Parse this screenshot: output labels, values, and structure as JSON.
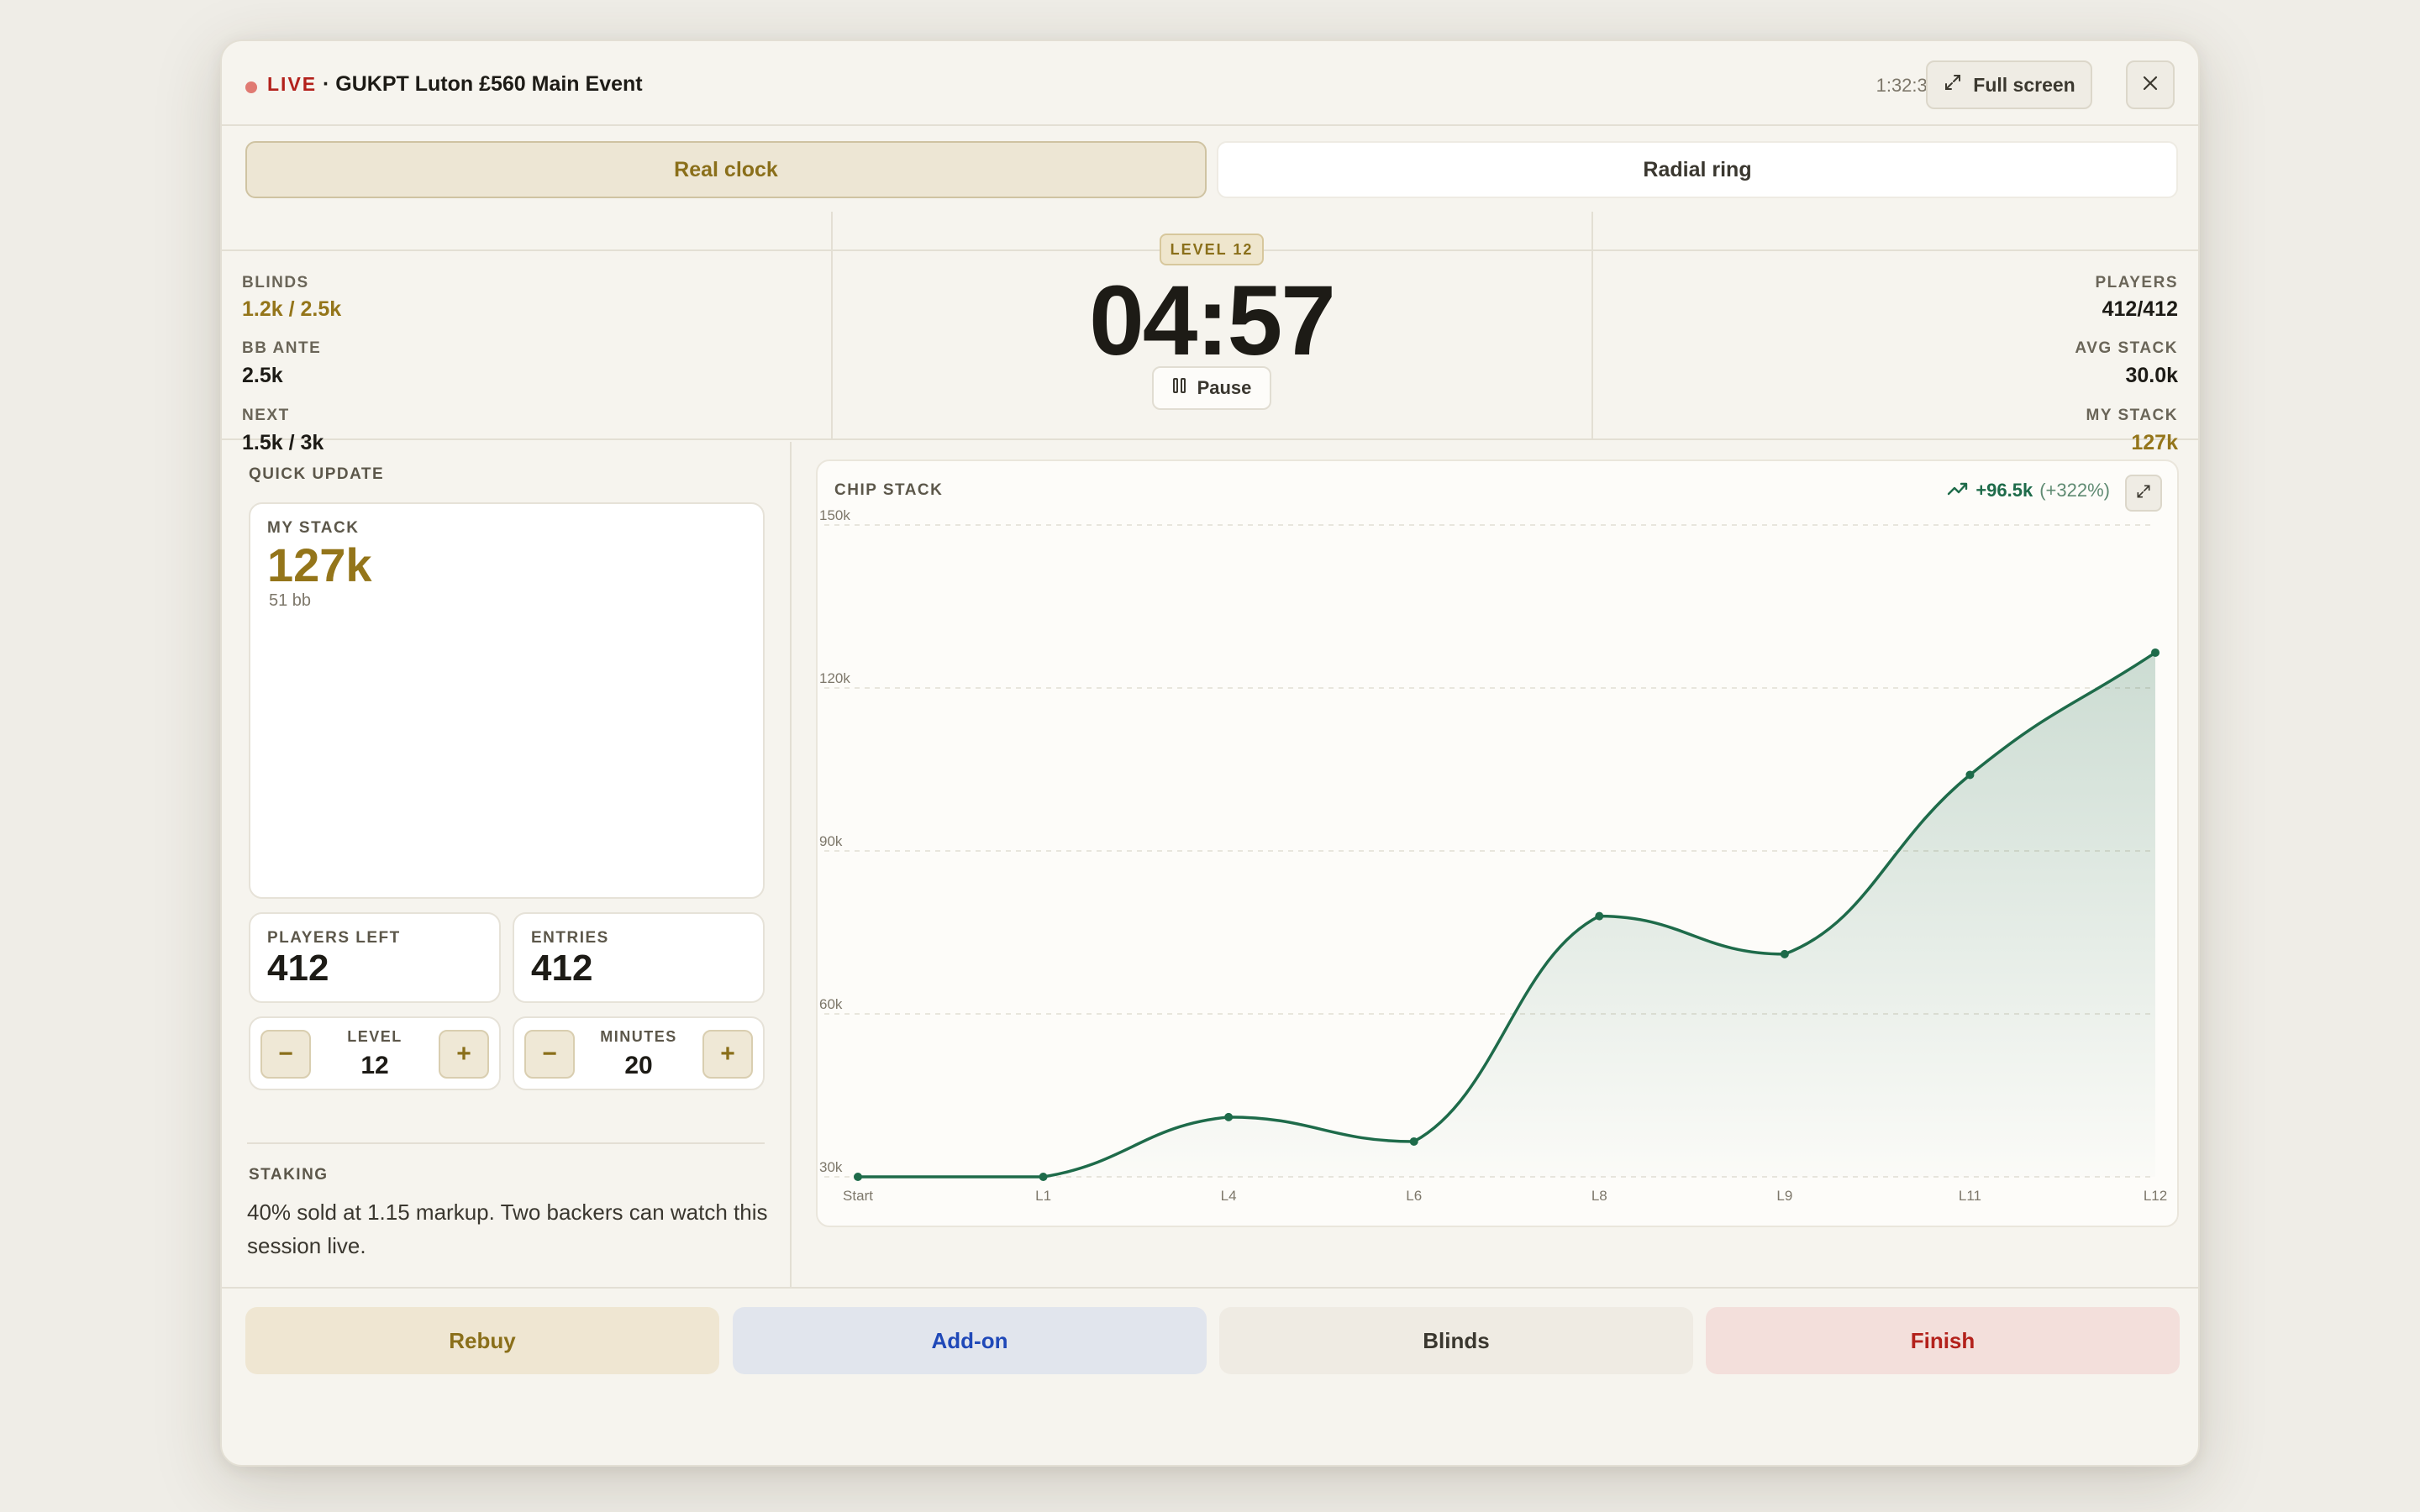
{
  "header": {
    "live_label": "LIVE",
    "event_title": "· GUKPT Luton £560 Main Event",
    "elapsed": "1:32:31",
    "fullscreen_label": "Full screen"
  },
  "tabs": [
    {
      "label": "Real clock",
      "active": true
    },
    {
      "label": "Radial ring",
      "active": false
    }
  ],
  "stats": {
    "blinds_label": "BLINDS",
    "blinds_value": "1.2k / 2.5k",
    "ante_label": "BB ANTE",
    "ante_value": "2.5k",
    "next_label": "NEXT",
    "next_value": "1.5k / 3k",
    "level_badge": "LEVEL 12",
    "clock": "04:57",
    "pause_label": "Pause",
    "players_label": "PLAYERS",
    "players_value": "412/412",
    "avg_stack_label": "AVG STACK",
    "avg_stack_value": "30.0k",
    "my_stack_label": "MY STACK",
    "my_stack_value": "127k"
  },
  "quick_update": {
    "title": "QUICK UPDATE",
    "my_stack_label": "MY STACK",
    "my_stack_value": "127k",
    "my_stack_bb": "51 bb",
    "players_left_label": "PLAYERS LEFT",
    "players_left_value": "412",
    "entries_label": "ENTRIES",
    "entries_value": "412",
    "level_label": "LEVEL",
    "level_value": "12",
    "minutes_label": "MINUTES",
    "minutes_value": "20",
    "minus": "−",
    "plus": "+"
  },
  "staking": {
    "title": "STAKING",
    "text": "40% sold at 1.15 markup. Two backers can watch this session live."
  },
  "chart_panel": {
    "title": "CHIP STACK",
    "delta_value": "+96.5k",
    "delta_pct": "(+322%)"
  },
  "chart_data": {
    "type": "area",
    "title": "CHIP STACK",
    "x": [
      "Start",
      "L1",
      "L4",
      "L6",
      "L8",
      "L9",
      "L11",
      "L12"
    ],
    "series": [
      {
        "values": [
          30000,
          30000,
          41000,
          36500,
          78000,
          71000,
          104000,
          126500
        ]
      }
    ],
    "ylim": [
      30000,
      150000
    ],
    "yticks": [
      30000,
      60000,
      90000,
      120000,
      150000
    ],
    "ytick_labels": [
      "30k",
      "60k",
      "90k",
      "120k",
      "150k"
    ],
    "grid": true,
    "line_color": "#1e6b4a"
  },
  "actions": {
    "rebuy": "Rebuy",
    "addon": "Add-on",
    "blinds": "Blinds",
    "finish": "Finish"
  },
  "colors": {
    "accent_gold": "#94751a",
    "live_red": "#b3211b",
    "positive_green": "#1e6b4a",
    "addon_blue": "#1f48b8"
  }
}
